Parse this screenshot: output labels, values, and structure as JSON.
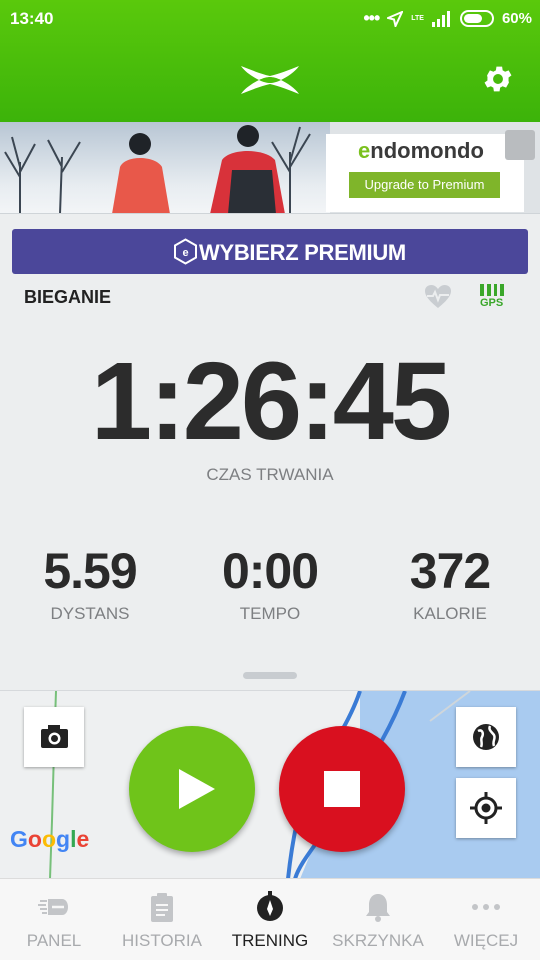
{
  "status_bar": {
    "time": "13:40",
    "network": "LTE",
    "battery": "60%"
  },
  "header": {
    "logo_icon": "under-armour-logo",
    "settings_icon": "gear-icon"
  },
  "ad_banner": {
    "brand": "ndomondo",
    "brand_prefix": "e",
    "button_label": "Upgrade to Premium"
  },
  "premium_button": {
    "label": "WYBIERZ PREMIUM"
  },
  "workout": {
    "sport": "BIEGANIE",
    "gps_label": "GPS",
    "duration": "1:26:45",
    "duration_label": "CZAS TRWANIA",
    "stats": [
      {
        "value": "5.59",
        "label": "DYSTANS"
      },
      {
        "value": "0:00",
        "label": "TEMPO"
      },
      {
        "value": "372",
        "label": "KALORIE"
      }
    ]
  },
  "map": {
    "attribution": [
      "G",
      "o",
      "o",
      "g",
      "l",
      "e"
    ]
  },
  "bottom_nav": {
    "items": [
      {
        "label": "PANEL",
        "icon": "endomondo-icon",
        "active": false
      },
      {
        "label": "HISTORIA",
        "icon": "clipboard-icon",
        "active": false
      },
      {
        "label": "TRENING",
        "icon": "compass-icon",
        "active": true
      },
      {
        "label": "SKRZYNKA",
        "icon": "bell-icon",
        "active": false
      },
      {
        "label": "WIĘCEJ",
        "icon": "more-dots-icon",
        "active": false
      }
    ]
  },
  "colors": {
    "header_green": "#4cbf0b",
    "premium_purple": "#4b479a",
    "play_green": "#6fc41a",
    "stop_red": "#d9101f"
  }
}
